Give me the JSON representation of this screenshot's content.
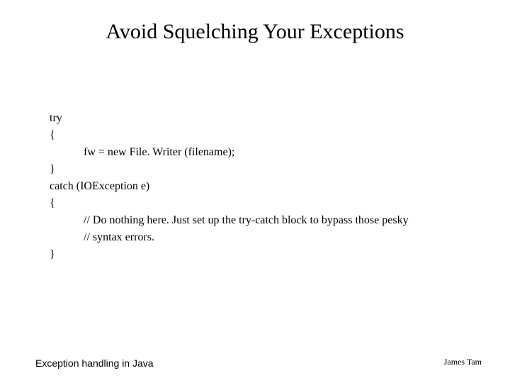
{
  "title": "Avoid Squelching Your Exceptions",
  "code": {
    "l1": "try",
    "l2": "{",
    "l3": "fw = new File. Writer (filename);",
    "l4": "}",
    "l5": "catch (IOException e)",
    "l6": "{",
    "l7": "// Do nothing here.  Just set up the try-catch block to bypass those pesky",
    "l8": "// syntax errors.",
    "l9": "}"
  },
  "footer": {
    "left": "Exception handling in Java",
    "right": "James Tam"
  }
}
